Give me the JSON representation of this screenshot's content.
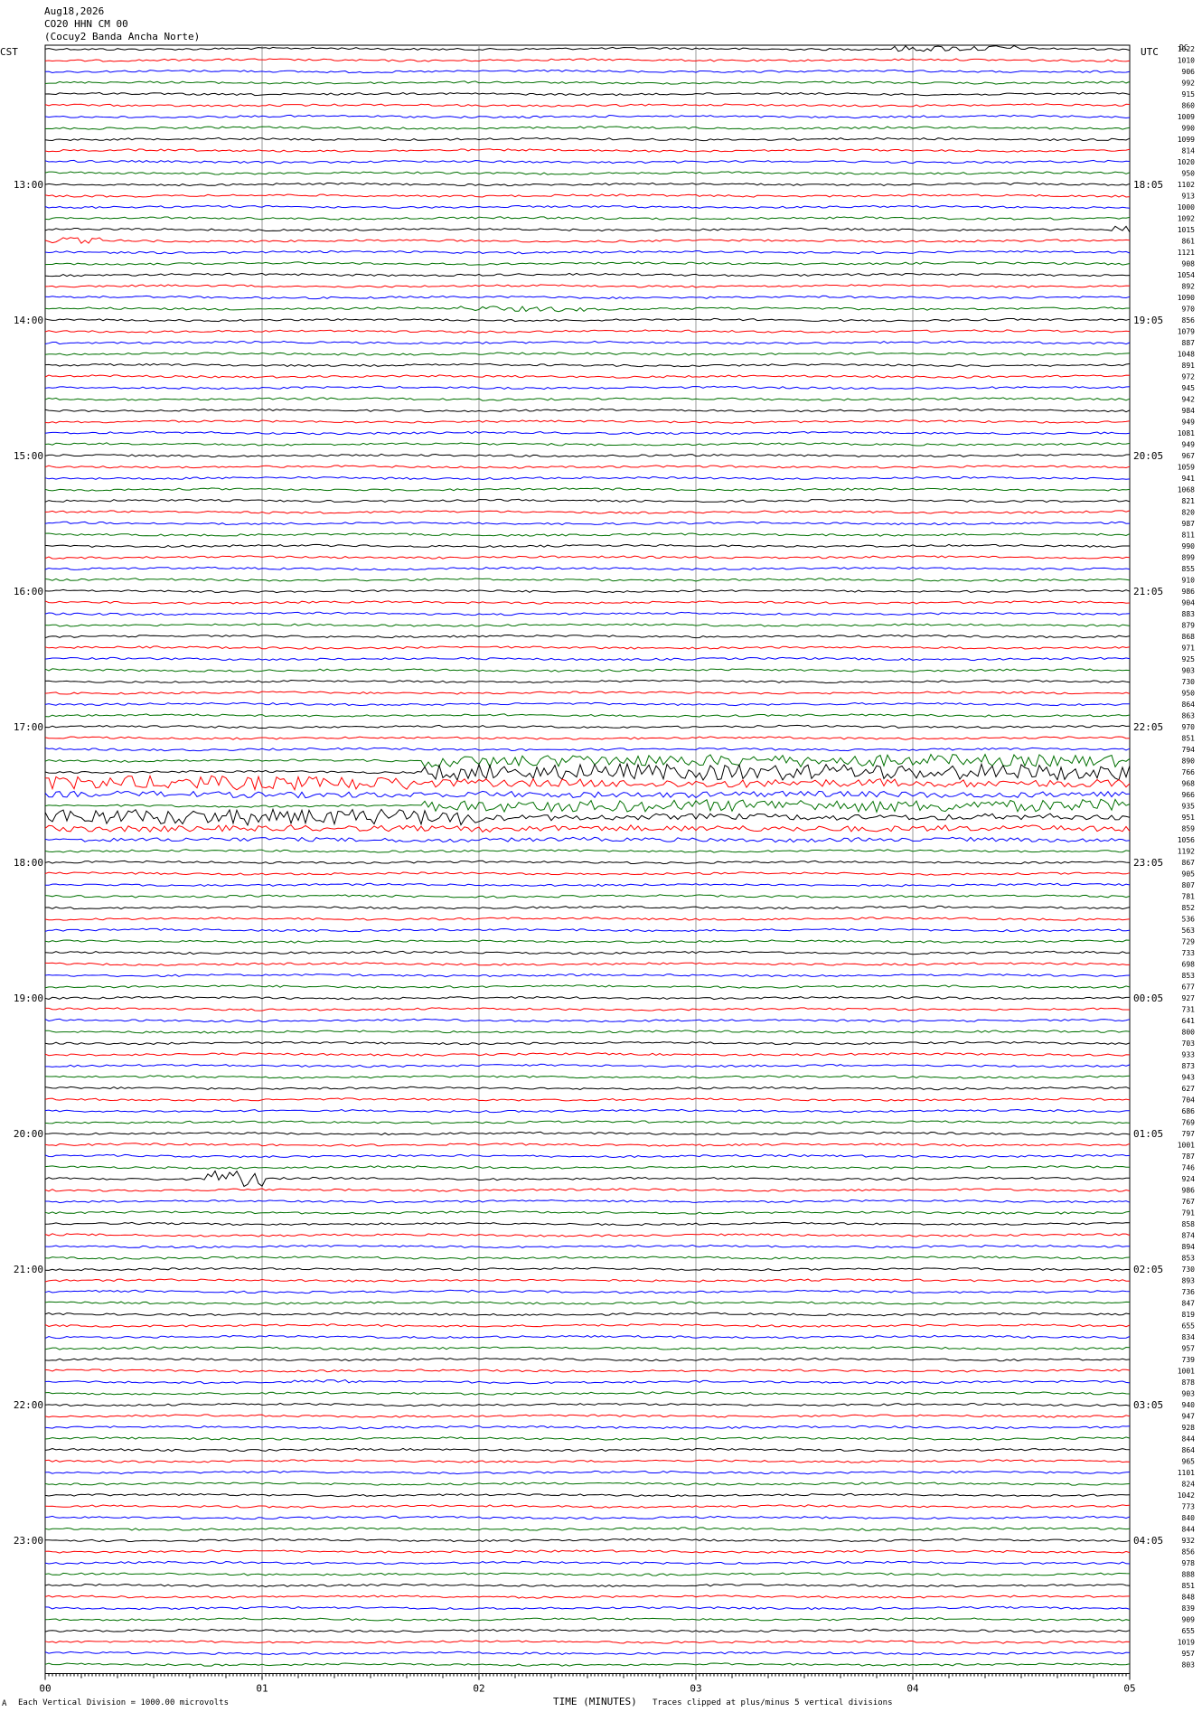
{
  "header": {
    "date": "Aug18,2026",
    "station": "CO20 HHN CM 00",
    "site": "(Cocuy2 Banda Ancha Norte)"
  },
  "left_axis_label": "CST",
  "right_axis_label": "UTC",
  "corner_label": "DC",
  "footer": {
    "scale_note": "Each Vertical Division = 1000.00 microvolts",
    "xlabel": "TIME (MINUTES)",
    "clip_note": "Traces clipped at plus/minus 5 vertical divisions",
    "corner_mark": "A"
  },
  "colors": {
    "trace_cycle": [
      "#000000",
      "#ff0000",
      "#0000ff",
      "#007000"
    ],
    "grid": "#999999"
  },
  "chart_data": {
    "type": "line",
    "x_ticks": [
      "00",
      "01",
      "02",
      "03",
      "04",
      "05"
    ],
    "xlim": [
      0,
      5
    ],
    "trace_count": 144,
    "minutes_per_trace": 5,
    "left_hour_labels": [
      "13:00",
      "14:00",
      "15:00",
      "16:00",
      "17:00",
      "18:00",
      "19:00",
      "20:00",
      "21:00",
      "22:00",
      "23:00"
    ],
    "right_hour_labels": [
      "18:05",
      "19:05",
      "20:05",
      "21:05",
      "22:05",
      "23:05",
      "00:05",
      "01:05",
      "02:05",
      "03:05",
      "04:05"
    ],
    "dc_offsets": [
      1022,
      1010,
      906,
      992,
      915,
      860,
      1009,
      990,
      1099,
      814,
      1020,
      950,
      1102,
      913,
      1000,
      1092,
      1015,
      861,
      1121,
      908,
      1054,
      892,
      1090,
      970,
      856,
      1079,
      887,
      1048,
      891,
      972,
      945,
      942,
      984,
      949,
      1081,
      949,
      967,
      1059,
      941,
      1068,
      821,
      820,
      987,
      811,
      990,
      899,
      855,
      910,
      986,
      904,
      883,
      879,
      868,
      971,
      925,
      903,
      730,
      950,
      864,
      863,
      970,
      851,
      794,
      890,
      766,
      968,
      966,
      935,
      951,
      859,
      1056,
      1192,
      867,
      905,
      807,
      781,
      852,
      536,
      563,
      729,
      733,
      698,
      853,
      677,
      927,
      731,
      641,
      800,
      703,
      933,
      873,
      943,
      627,
      704,
      686,
      769,
      797,
      1001,
      787,
      746,
      924,
      986,
      767,
      791,
      858,
      874,
      894,
      853,
      730,
      893,
      736,
      847,
      819,
      655,
      834,
      957,
      739,
      1001,
      878,
      903,
      940,
      947,
      928,
      844,
      864,
      965,
      1101,
      824,
      1042,
      773,
      840,
      844,
      932,
      856,
      978,
      888,
      851,
      848,
      839,
      909,
      655,
      1019,
      957,
      803
    ]
  }
}
